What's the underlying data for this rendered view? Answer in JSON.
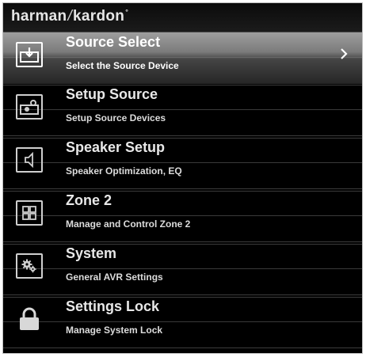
{
  "brand": {
    "left": "harman",
    "separator": "/",
    "right": "kardon",
    "mark": "°"
  },
  "menu": {
    "items": [
      {
        "title": "Source Select",
        "subtitle": "Select the Source Device",
        "icon": "source-select-icon",
        "selected": true
      },
      {
        "title": "Setup Source",
        "subtitle": "Setup Source Devices",
        "icon": "setup-source-icon",
        "selected": false
      },
      {
        "title": "Speaker Setup",
        "subtitle": "Speaker Optimization, EQ",
        "icon": "speaker-icon",
        "selected": false
      },
      {
        "title": "Zone 2",
        "subtitle": "Manage and Control Zone 2",
        "icon": "zone-grid-icon",
        "selected": false
      },
      {
        "title": "System",
        "subtitle": "General AVR Settings",
        "icon": "gears-icon",
        "selected": false
      },
      {
        "title": "Settings Lock",
        "subtitle": "Manage System Lock",
        "icon": "lock-icon",
        "selected": false
      }
    ]
  },
  "colors": {
    "background": "#000000",
    "text": "#e8e8e8",
    "selected_highlight": "#8a8a8a",
    "divider": "#3a3a3a"
  }
}
